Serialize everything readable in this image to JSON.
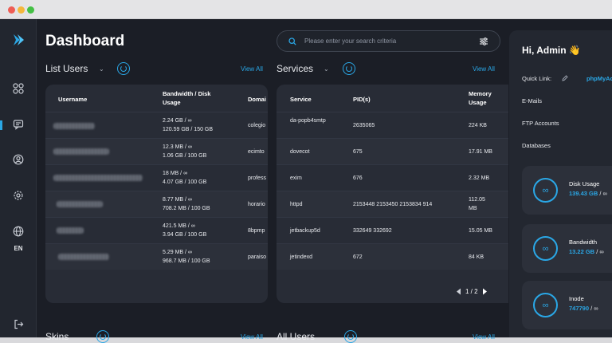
{
  "header": {
    "title": "Dashboard"
  },
  "search": {
    "placeholder": "Please enter your search criteria"
  },
  "sidebar": {
    "language": "EN"
  },
  "users": {
    "title": "List Users",
    "view_all": "View All",
    "columns": [
      "Username",
      "Bandwidth / Disk Usage",
      "Domai"
    ],
    "rows": [
      {
        "bandwidth": "2.24 GB  /  ∞",
        "disk": "120.59 GB  /  150 GB",
        "domain": "colegio"
      },
      {
        "bandwidth": "12.3 MB  /  ∞",
        "disk": "1.06 GB  /  100 GB",
        "domain": "ecimto"
      },
      {
        "bandwidth": "18 MB  /  ∞",
        "disk": "4.07 GB  /  100 GB",
        "domain": "profess"
      },
      {
        "bandwidth": "8.77 MB  /  ∞",
        "disk": "708.2 MB  /  100 GB",
        "domain": "horario"
      },
      {
        "bandwidth": "421.5 MB  /  ∞",
        "disk": "3.94 GB  /  100 GB",
        "domain": "8bpmp"
      },
      {
        "bandwidth": "5.29 MB  /  ∞",
        "disk": "968.7 MB  /  100 GB",
        "domain": "paraiso"
      }
    ]
  },
  "services": {
    "title": "Services",
    "view_all": "View All",
    "columns": [
      "Service",
      "PID(s)",
      "Memory Usage"
    ],
    "rows": [
      {
        "service": "da-popb4smtp",
        "pid": "2635065",
        "memory": "224 KB"
      },
      {
        "service": "dovecot",
        "pid": "675",
        "memory": "17.91 MB"
      },
      {
        "service": "exim",
        "pid": "676",
        "memory": "2.32 MB"
      },
      {
        "service": "httpd",
        "pid": "2153448 2153450 2153834 914",
        "memory": "112.05 MB"
      },
      {
        "service": "jetbackup5d",
        "pid": "332649 332692",
        "memory": "15.05 MB"
      },
      {
        "service": "jetindexd",
        "pid": "672",
        "memory": "84 KB"
      }
    ],
    "pager": "1 / 2"
  },
  "bottom": {
    "skins": "Skins",
    "all_users": "All Users",
    "view_all": "View All"
  },
  "right_panel": {
    "greeting": "Hi, Admin 👋",
    "quick_link_label": "Quick Link:",
    "quick_link_value": "phpMyAd",
    "links": [
      "E-Mails",
      "FTP Accounts",
      "Databases"
    ],
    "cards": [
      {
        "title": "Disk Usage",
        "value": "139.43 GB",
        "suffix": " / ∞"
      },
      {
        "title": "Bandwidth",
        "value": "13.22 GB",
        "suffix": " / ∞"
      },
      {
        "title": "Inode",
        "value": "747790",
        "suffix": " / ∞"
      }
    ]
  },
  "colors": {
    "accent": "#2aa7e6",
    "background": "#1b1e26",
    "panel": "#282c36"
  },
  "icons": [
    "logo-icon",
    "grid-icon",
    "message-icon",
    "user-circle-icon",
    "gear-icon",
    "globe-icon",
    "logout-icon",
    "search-icon",
    "filter-icon",
    "refresh-icon",
    "chevron-down-icon",
    "pencil-icon",
    "infinity-icon"
  ]
}
